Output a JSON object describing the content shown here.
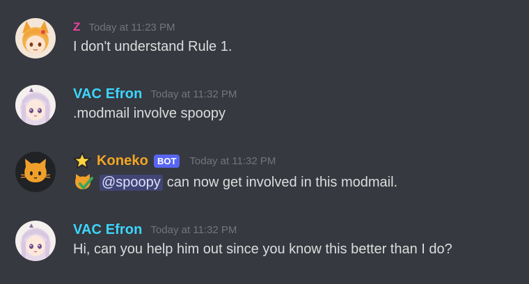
{
  "colors": {
    "background": "#36393f",
    "username_z": "#eb459f",
    "username_vac": "#3dd6ff",
    "username_bot": "#f5a623",
    "timestamp": "#72767d",
    "text": "#dcddde",
    "bot_badge": "#5865f2",
    "mention_bg": "#444a8c"
  },
  "messages": [
    {
      "author": "Z",
      "timestamp": "Today at 11:23 PM",
      "text": "I don't understand Rule 1.",
      "avatar_icon": "fox-girl-avatar-icon"
    },
    {
      "author": "VAC Efron",
      "timestamp": "Today at 11:32 PM",
      "text": ".modmail involve spoopy",
      "avatar_icon": "anime-girl-avatar-icon"
    },
    {
      "author": "Koneko",
      "bot_badge": "BOT",
      "timestamp": "Today at 11:32 PM",
      "mention": "@spoopy",
      "text": "can now get involved in this modmail.",
      "avatar_icon": "cat-avatar-icon",
      "prefix_icon": "star-icon",
      "emoji_icon": "cat-check-emoji-icon"
    },
    {
      "author": "VAC Efron",
      "timestamp": "Today at 11:32 PM",
      "text": "Hi, can you help him out since you know this better than I do?",
      "avatar_icon": "anime-girl-avatar-icon"
    }
  ]
}
